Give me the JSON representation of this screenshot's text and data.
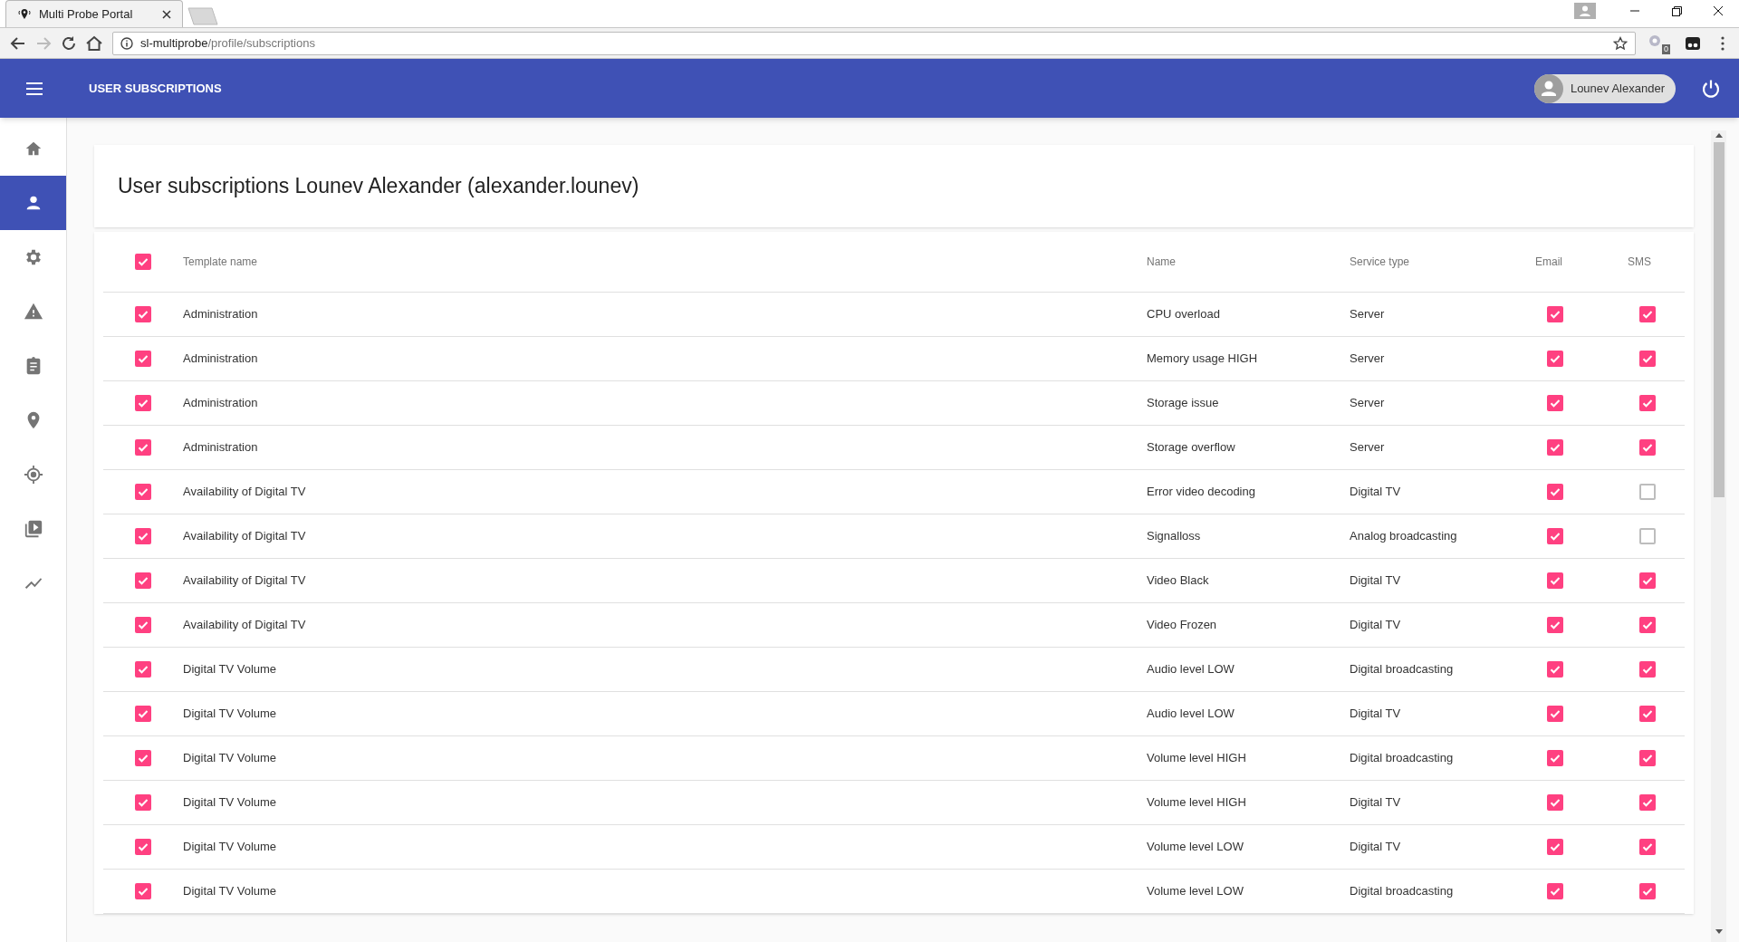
{
  "browser": {
    "tab_title": "Multi Probe Portal",
    "url_host": "sl-multiprobe",
    "url_path": "/profile/subscriptions",
    "extension_badge": "0"
  },
  "app_bar": {
    "title": "USER SUBSCRIPTIONS",
    "user": "Lounev Alexander"
  },
  "sidebar": {
    "items": [
      {
        "kind": "home",
        "selected": false
      },
      {
        "kind": "person",
        "selected": true
      },
      {
        "kind": "gear",
        "selected": false
      },
      {
        "kind": "warning",
        "selected": false
      },
      {
        "kind": "clipboard",
        "selected": false
      },
      {
        "kind": "pin",
        "selected": false
      },
      {
        "kind": "target",
        "selected": false
      },
      {
        "kind": "video",
        "selected": false
      },
      {
        "kind": "chart",
        "selected": false
      }
    ]
  },
  "page_title": "User subscriptions Lounev Alexander (alexander.lounev)",
  "table": {
    "select_all": {
      "checked": true
    },
    "columns": [
      "Template name",
      "Name",
      "Service type",
      "Email",
      "SMS"
    ],
    "rows": [
      {
        "checked": true,
        "template": "Administration",
        "name": "CPU overload",
        "service_type": "Server",
        "email": true,
        "sms": true
      },
      {
        "checked": true,
        "template": "Administration",
        "name": "Memory usage HIGH",
        "service_type": "Server",
        "email": true,
        "sms": true
      },
      {
        "checked": true,
        "template": "Administration",
        "name": "Storage issue",
        "service_type": "Server",
        "email": true,
        "sms": true
      },
      {
        "checked": true,
        "template": "Administration",
        "name": "Storage overflow",
        "service_type": "Server",
        "email": true,
        "sms": true
      },
      {
        "checked": true,
        "template": "Availability of Digital TV",
        "name": "Error video decoding",
        "service_type": "Digital TV",
        "email": true,
        "sms": false
      },
      {
        "checked": true,
        "template": "Availability of Digital TV",
        "name": "Signalloss",
        "service_type": "Analog broadcasting",
        "email": true,
        "sms": false
      },
      {
        "checked": true,
        "template": "Availability of Digital TV",
        "name": "Video Black",
        "service_type": "Digital TV",
        "email": true,
        "sms": true
      },
      {
        "checked": true,
        "template": "Availability of Digital TV",
        "name": "Video Frozen",
        "service_type": "Digital TV",
        "email": true,
        "sms": true
      },
      {
        "checked": true,
        "template": "Digital TV Volume",
        "name": "Audio level LOW",
        "service_type": "Digital broadcasting",
        "email": true,
        "sms": true
      },
      {
        "checked": true,
        "template": "Digital TV Volume",
        "name": "Audio level LOW",
        "service_type": "Digital TV",
        "email": true,
        "sms": true
      },
      {
        "checked": true,
        "template": "Digital TV Volume",
        "name": "Volume level HIGH",
        "service_type": "Digital broadcasting",
        "email": true,
        "sms": true
      },
      {
        "checked": true,
        "template": "Digital TV Volume",
        "name": "Volume level HIGH",
        "service_type": "Digital TV",
        "email": true,
        "sms": true
      },
      {
        "checked": true,
        "template": "Digital TV Volume",
        "name": "Volume level LOW",
        "service_type": "Digital TV",
        "email": true,
        "sms": true
      },
      {
        "checked": true,
        "template": "Digital TV Volume",
        "name": "Volume level LOW",
        "service_type": "Digital broadcasting",
        "email": true,
        "sms": true
      }
    ]
  }
}
